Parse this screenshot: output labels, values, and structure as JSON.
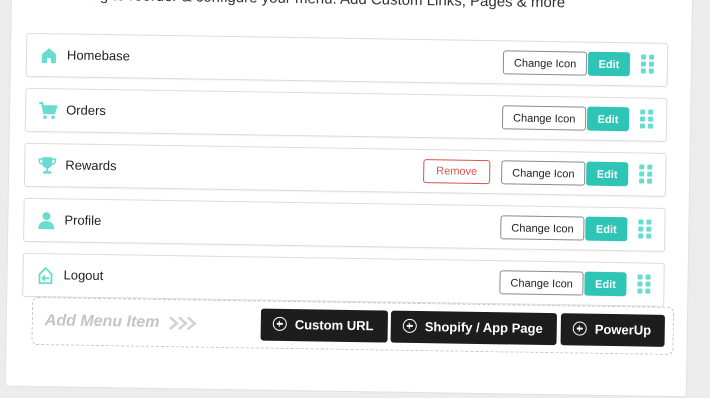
{
  "intro_text": "Click & Drag to reorder & configure your menu. Add Custom Links, Pages & more",
  "colors": {
    "accent": "#2ec4b6",
    "icon": "#67dccf",
    "remove": "#d9534f",
    "dark_button": "#1d1d1d"
  },
  "menu_items": [
    {
      "label": "Homebase",
      "icon": "home-icon",
      "change_icon": "Change Icon",
      "edit": "Edit"
    },
    {
      "label": "Orders",
      "icon": "cart-icon",
      "change_icon": "Change Icon",
      "edit": "Edit"
    },
    {
      "label": "Rewards",
      "icon": "trophy-icon",
      "change_icon": "Change Icon",
      "edit": "Edit",
      "remove": "Remove"
    },
    {
      "label": "Profile",
      "icon": "user-icon",
      "change_icon": "Change Icon",
      "edit": "Edit"
    },
    {
      "label": "Logout",
      "icon": "logout-icon",
      "change_icon": "Change Icon",
      "edit": "Edit"
    }
  ],
  "add_menu": {
    "label": "Add Menu Item",
    "buttons": [
      "Custom URL",
      "Shopify / App Page",
      "PowerUp"
    ]
  }
}
